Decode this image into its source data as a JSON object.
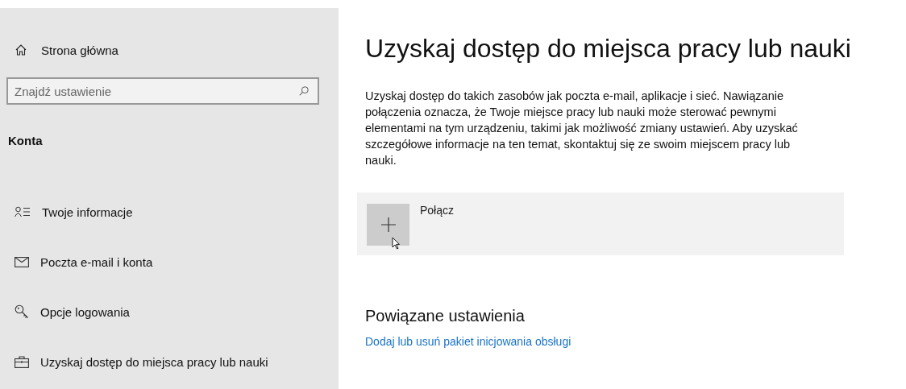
{
  "sidebar": {
    "home": "Strona główna",
    "search": {
      "placeholder": "Znajdź ustawienie"
    },
    "section": "Konta",
    "items": [
      {
        "label": "Twoje informacje",
        "kind": "person"
      },
      {
        "label": "Poczta e-mail i konta",
        "kind": "mail"
      },
      {
        "label": "Opcje logowania",
        "kind": "key"
      },
      {
        "label": "Uzyskaj dostęp do miejsca pracy lub nauki",
        "kind": "briefcase"
      }
    ]
  },
  "main": {
    "title": "Uzyskaj dostęp do miejsca pracy lub nauki",
    "description": "Uzyskaj dostęp do takich zasobów jak poczta e-mail, aplikacje i sieć. Nawiązanie połączenia oznacza, że Twoje miejsce pracy lub nauki może sterować pewnymi elementami na tym urządzeniu, takimi jak możliwość zmiany ustawień. Aby uzyskać szczegółowe informacje na ten temat, skontaktuj się ze swoim miejscem pracy lub nauki.",
    "connect": {
      "label": "Połącz"
    },
    "related": {
      "heading": "Powiązane ustawienia",
      "links": [
        "Dodaj lub usuń pakiet inicjowania obsługi"
      ]
    }
  }
}
